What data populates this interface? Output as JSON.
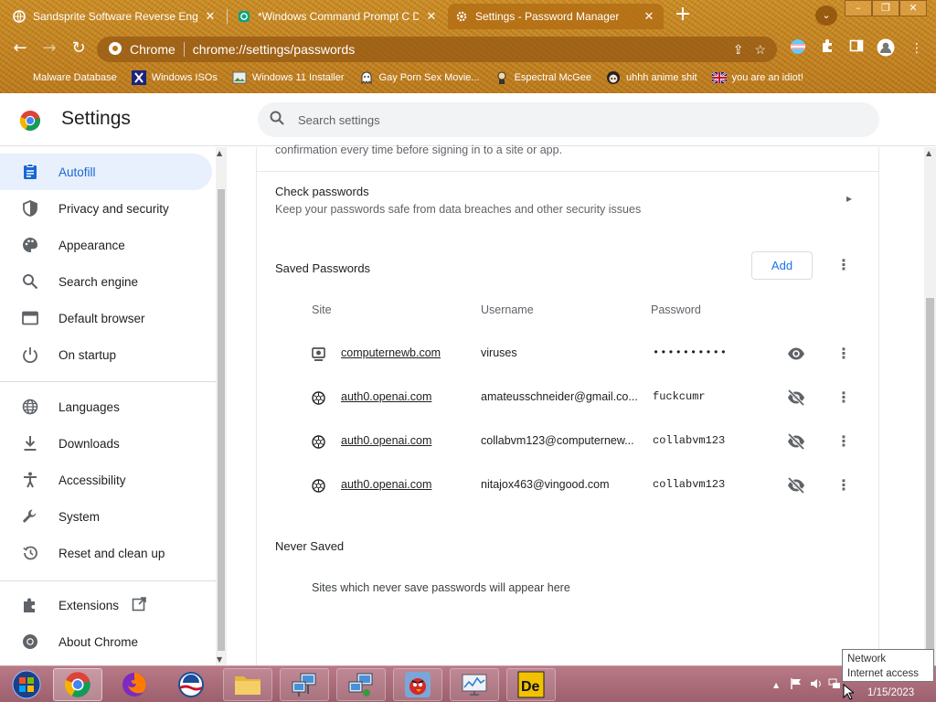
{
  "browser": {
    "tabs": [
      {
        "title": "Sandsprite Software Reverse Eng",
        "close": "✕",
        "icon": "sandsprite-favicon",
        "active": false
      },
      {
        "title": "*Windows Command Prompt C Dri",
        "close": "✕",
        "icon": "openai-favicon",
        "active": false
      },
      {
        "title": "Settings - Password Manager",
        "close": "✕",
        "icon": "gear-icon",
        "active": true
      }
    ],
    "new_tab": "+",
    "omnibox": {
      "chip_label": "Chrome",
      "url": "chrome://settings/passwords"
    },
    "bookmarks": [
      {
        "label": "Malware Database",
        "icon": "blank-icon"
      },
      {
        "label": "Windows ISOs",
        "icon": "x-icon"
      },
      {
        "label": "Windows 11 Installer",
        "icon": "image-icon"
      },
      {
        "label": "Gay Porn Sex Movie...",
        "icon": "ghost-icon"
      },
      {
        "label": "Espectral McGee",
        "icon": "character-icon"
      },
      {
        "label": "uhhh anime shit",
        "icon": "anime-icon"
      },
      {
        "label": "you are an idiot!",
        "icon": "flag-icon"
      }
    ]
  },
  "settings": {
    "title": "Settings",
    "search_placeholder": "Search settings"
  },
  "sidebar": {
    "items": [
      {
        "label": "Autofill",
        "icon": "clipboard-icon",
        "active": true
      },
      {
        "label": "Privacy and security",
        "icon": "shield-icon"
      },
      {
        "label": "Appearance",
        "icon": "palette-icon"
      },
      {
        "label": "Search engine",
        "icon": "search-icon"
      },
      {
        "label": "Default browser",
        "icon": "browser-icon"
      },
      {
        "label": "On startup",
        "icon": "power-icon"
      },
      {
        "label": "Languages",
        "icon": "globe-icon"
      },
      {
        "label": "Downloads",
        "icon": "download-icon"
      },
      {
        "label": "Accessibility",
        "icon": "accessibility-icon"
      },
      {
        "label": "System",
        "icon": "wrench-icon"
      },
      {
        "label": "Reset and clean up",
        "icon": "history-icon"
      },
      {
        "label": "Extensions",
        "icon": "puzzle-icon"
      },
      {
        "label": "About Chrome",
        "icon": "chrome-icon"
      }
    ]
  },
  "main": {
    "confirm_text": "confirmation every time before signing in to a site or app.",
    "check": {
      "title": "Check passwords",
      "subtitle": "Keep your passwords safe from data breaches and other security issues"
    },
    "saved": {
      "title": "Saved Passwords",
      "add_label": "Add",
      "columns": [
        "Site",
        "Username",
        "Password"
      ],
      "rows": [
        {
          "site": "computernewb.com",
          "username": "viruses",
          "password": "••••••••••",
          "visible": false,
          "icon": "computernewb-favicon"
        },
        {
          "site": "auth0.openai.com",
          "username": "amateusschneider@gmail.co...",
          "password": "fuckcumr",
          "visible": true,
          "icon": "openai-favicon"
        },
        {
          "site": "auth0.openai.com",
          "username": "collabvm123@computernew...",
          "password": "collabvm123",
          "visible": true,
          "icon": "openai-favicon"
        },
        {
          "site": "auth0.openai.com",
          "username": "nitajox463@vingood.com",
          "password": "collabvm123",
          "visible": true,
          "icon": "openai-favicon"
        }
      ]
    },
    "never_saved": {
      "title": "Never Saved",
      "empty_text": "Sites which never save passwords will appear here"
    }
  },
  "taskbar": {
    "items": [
      "start-orb",
      "chrome",
      "firefox",
      "obama-app",
      "file-explorer",
      "network-app-1",
      "network-app-2",
      "angry-birds",
      "monitor-app",
      "de-app"
    ],
    "clock": "1/15/2023",
    "tooltip_line1": "Network",
    "tooltip_line2": "Internet access"
  },
  "colors": {
    "accent": "#1a73e8",
    "active_nav_bg": "#e8f0fe",
    "theme_orange": "#c98a22",
    "taskbar": "#ac6d7a"
  }
}
